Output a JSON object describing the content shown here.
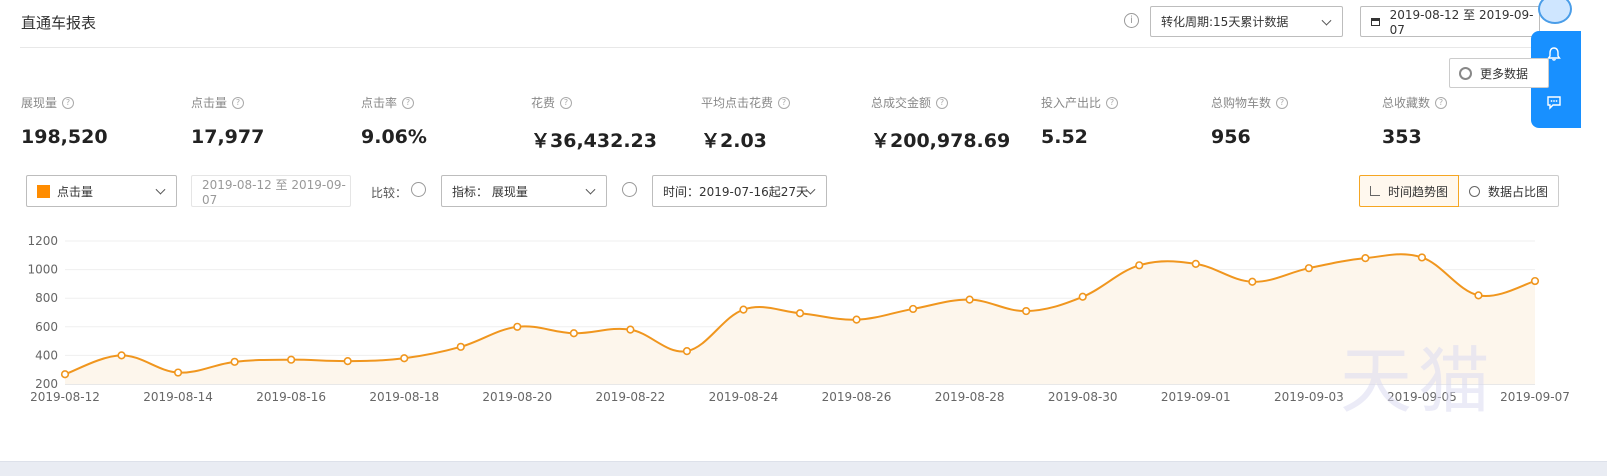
{
  "header": {
    "title": "直通车报表",
    "help_glyph": "i",
    "period_select": "转化周期:15天累计数据",
    "date_range": "2019-08-12 至 2019-09-07"
  },
  "more_data_label": "更多数据",
  "metrics": [
    {
      "label": "展现量",
      "value": "198,520"
    },
    {
      "label": "点击量",
      "value": "17,977"
    },
    {
      "label": "点击率",
      "value": "9.06%"
    },
    {
      "label": "花费",
      "value": "￥36,432.23"
    },
    {
      "label": "平均点击花费",
      "value": "￥2.03"
    },
    {
      "label": "总成交金额",
      "value": "￥200,978.69"
    },
    {
      "label": "投入产出比",
      "value": "5.52"
    },
    {
      "label": "总购物车数",
      "value": "956"
    },
    {
      "label": "总收藏数",
      "value": "353"
    }
  ],
  "controls": {
    "metric_select": "点击量",
    "metric_color": "#ff8c00",
    "date_range": "2019-08-12 至 2019-09-07",
    "compare_label": "比较：",
    "index_select": "指标： 展现量",
    "time_select": "时间：2019-07-16起27天",
    "view_trend": "时间趋势图",
    "view_share": "数据占比图"
  },
  "watermark": "天猫",
  "chart_data": {
    "type": "area",
    "line_color": "#f0961e",
    "fill_color": "#fdf6ec",
    "grid": true,
    "y_ticks": [
      200,
      400,
      600,
      800,
      1000,
      1200
    ],
    "ylim": [
      200,
      1200
    ],
    "x_tick_labels": [
      "2019-08-12",
      "2019-08-14",
      "2019-08-16",
      "2019-08-18",
      "2019-08-20",
      "2019-08-22",
      "2019-08-24",
      "2019-08-26",
      "2019-08-28",
      "2019-08-30",
      "2019-09-01",
      "2019-09-03",
      "2019-09-05",
      "2019-09-07"
    ],
    "x": [
      "2019-08-12",
      "2019-08-13",
      "2019-08-14",
      "2019-08-15",
      "2019-08-16",
      "2019-08-17",
      "2019-08-18",
      "2019-08-19",
      "2019-08-20",
      "2019-08-21",
      "2019-08-22",
      "2019-08-23",
      "2019-08-24",
      "2019-08-25",
      "2019-08-26",
      "2019-08-27",
      "2019-08-28",
      "2019-08-29",
      "2019-08-30",
      "2019-08-31",
      "2019-09-01",
      "2019-09-02",
      "2019-09-03",
      "2019-09-04",
      "2019-09-05",
      "2019-09-06",
      "2019-09-07"
    ],
    "series": [
      {
        "values": [
          268,
          400,
          280,
          355,
          370,
          360,
          380,
          460,
          600,
          555,
          580,
          430,
          720,
          695,
          650,
          725,
          790,
          710,
          810,
          1030,
          1040,
          915,
          1010,
          1080,
          1085,
          820,
          920
        ]
      }
    ]
  }
}
